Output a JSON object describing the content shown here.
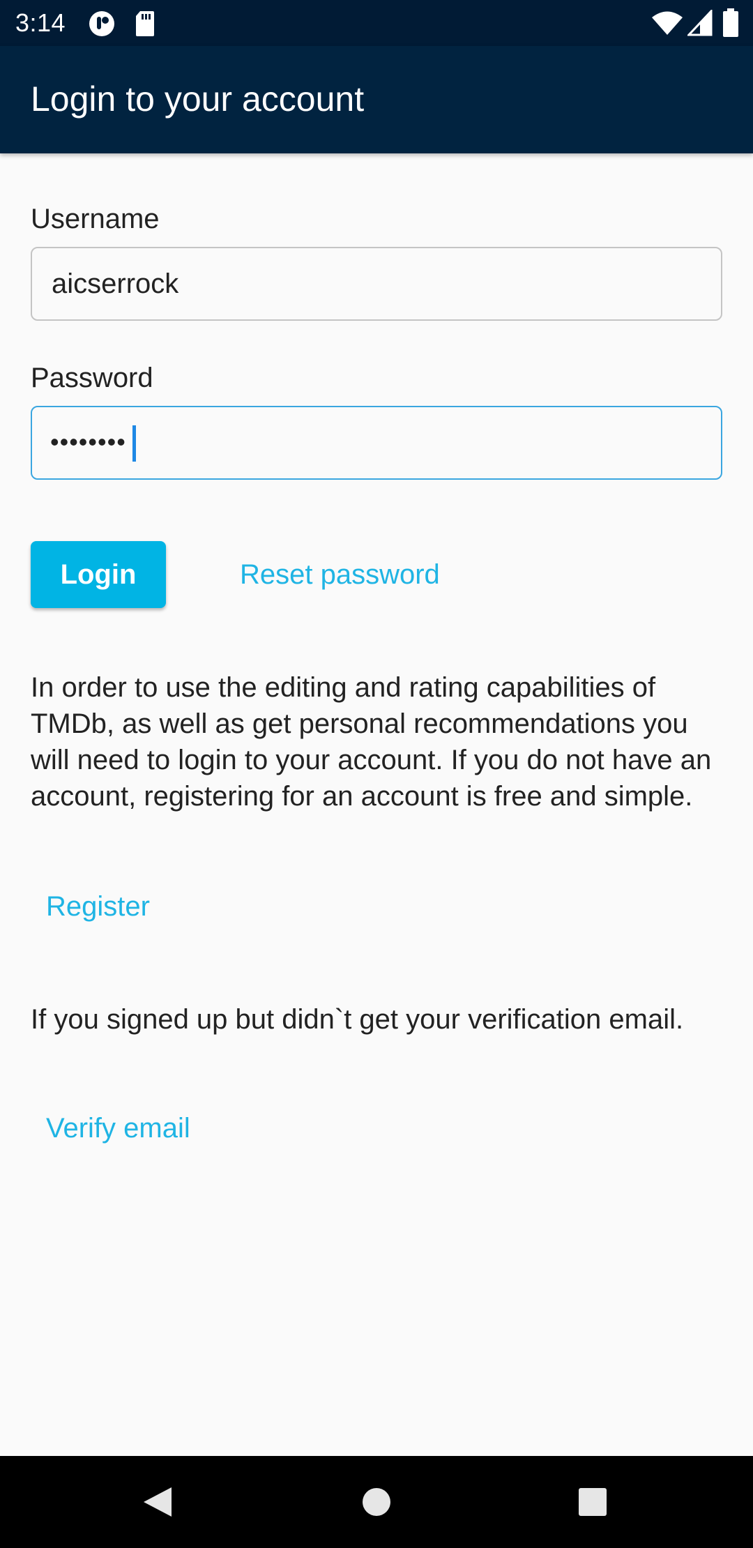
{
  "status_bar": {
    "time": "3:14",
    "icons": [
      "app-notification-icon",
      "sd-card-icon",
      "wifi-icon",
      "signal-icon",
      "battery-icon"
    ]
  },
  "app_bar": {
    "title": "Login to your account"
  },
  "form": {
    "username_label": "Username",
    "username_value": "aicserrock",
    "password_label": "Password",
    "password_value": "••••••••",
    "login_label": "Login",
    "reset_label": "Reset password"
  },
  "info": {
    "paragraph": "In order to use the editing and rating capabilities of TMDb, as well as get personal recommendations you will need to login to your account. If you do not have an account, registering for an account is free and simple.",
    "register_label": "Register",
    "verify_text": "If you signed up but didn`t get your verification email.",
    "verify_label": "Verify email"
  },
  "nav_bar": {
    "icons": [
      "back-icon",
      "home-icon",
      "recents-icon"
    ]
  },
  "colors": {
    "status_bar": "#011b35",
    "app_bar": "#012340",
    "accent": "#01b4e4",
    "link": "#1fb4e4",
    "focus_border": "#3aa6e0"
  }
}
